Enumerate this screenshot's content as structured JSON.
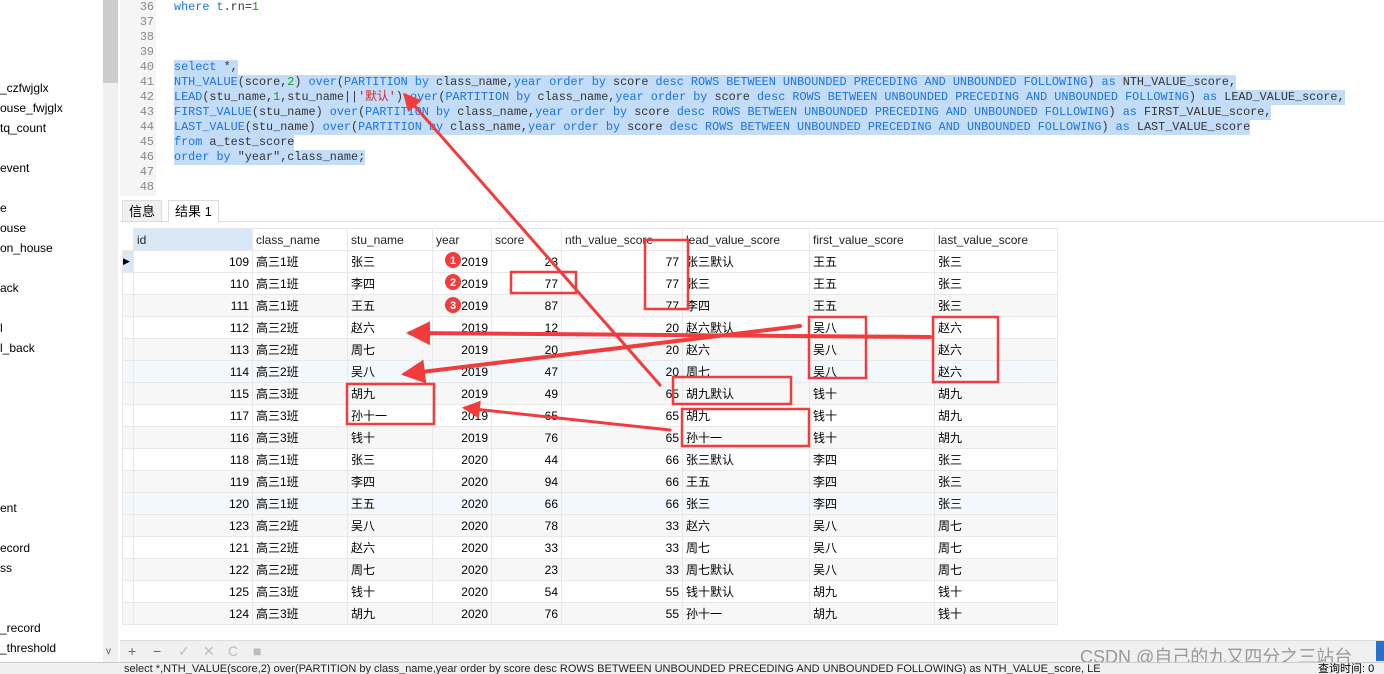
{
  "sidebar": {
    "items": [
      "_czfwjglx",
      "ouse_fwjglx",
      "tq_count",
      "event",
      "e",
      "ouse",
      "on_house",
      "ack",
      "l",
      "l_back",
      "ent",
      "ecord",
      "ss",
      "_record",
      "_threshold"
    ]
  },
  "editor": {
    "lines": [
      {
        "no": "36",
        "sel": false,
        "tokens": [
          [
            "where ",
            "kw"
          ],
          [
            "t",
            "kw"
          ],
          [
            ".rn=",
            "id"
          ],
          [
            "1",
            "num"
          ]
        ]
      },
      {
        "no": "37",
        "sel": false,
        "tokens": []
      },
      {
        "no": "38",
        "sel": false,
        "tokens": []
      },
      {
        "no": "39",
        "sel": false,
        "tokens": []
      },
      {
        "no": "40",
        "sel": true,
        "tokens": [
          [
            "select ",
            "kw"
          ],
          [
            "*,",
            "id"
          ]
        ]
      },
      {
        "no": "41",
        "sel": true,
        "tokens": [
          [
            "NTH_VALUE",
            "kw"
          ],
          [
            "(score,",
            "id"
          ],
          [
            "2",
            "num"
          ],
          [
            ") ",
            "id"
          ],
          [
            "over",
            "kw"
          ],
          [
            "(",
            "id"
          ],
          [
            "PARTITION by ",
            "kw"
          ],
          [
            "class_name,",
            "id"
          ],
          [
            "year order by ",
            "kw"
          ],
          [
            "score ",
            "id"
          ],
          [
            "desc ROWS BETWEEN UNBOUNDED PRECEDING AND UNBOUNDED FOLLOWING",
            "kw"
          ],
          [
            ") ",
            "id"
          ],
          [
            "as ",
            "kw"
          ],
          [
            "NTH_VALUE_score,",
            "id"
          ]
        ]
      },
      {
        "no": "42",
        "sel": true,
        "tokens": [
          [
            "LEAD",
            "kw"
          ],
          [
            "(stu_name,",
            "id"
          ],
          [
            "1",
            "num"
          ],
          [
            ",stu_name||",
            "id"
          ],
          [
            "'默认'",
            "str"
          ],
          [
            ") ",
            "id"
          ],
          [
            "over",
            "kw"
          ],
          [
            "(",
            "id"
          ],
          [
            "PARTITION by ",
            "kw"
          ],
          [
            "class_name,",
            "id"
          ],
          [
            "year order by ",
            "kw"
          ],
          [
            "score ",
            "id"
          ],
          [
            "desc ROWS BETWEEN UNBOUNDED PRECEDING AND UNBOUNDED FOLLOWING",
            "kw"
          ],
          [
            ") ",
            "id"
          ],
          [
            "as ",
            "kw"
          ],
          [
            "LEAD_VALUE_score,",
            "id"
          ]
        ]
      },
      {
        "no": "43",
        "sel": true,
        "tokens": [
          [
            "FIRST_VALUE",
            "kw"
          ],
          [
            "(stu_name) ",
            "id"
          ],
          [
            "over",
            "kw"
          ],
          [
            "(",
            "id"
          ],
          [
            "PARTITION by ",
            "kw"
          ],
          [
            "class_name,",
            "id"
          ],
          [
            "year order by ",
            "kw"
          ],
          [
            "score ",
            "id"
          ],
          [
            "desc ROWS BETWEEN UNBOUNDED PRECEDING AND UNBOUNDED FOLLOWING",
            "kw"
          ],
          [
            ") ",
            "id"
          ],
          [
            "as ",
            "kw"
          ],
          [
            "FIRST_VALUE_score,",
            "id"
          ]
        ]
      },
      {
        "no": "44",
        "sel": true,
        "tokens": [
          [
            "LAST_VALUE",
            "kw"
          ],
          [
            "(stu_name) ",
            "id"
          ],
          [
            "over",
            "kw"
          ],
          [
            "(",
            "id"
          ],
          [
            "PARTITION by ",
            "kw"
          ],
          [
            "class_name,",
            "id"
          ],
          [
            "year order by ",
            "kw"
          ],
          [
            "score ",
            "id"
          ],
          [
            "desc ROWS BETWEEN UNBOUNDED PRECEDING AND UNBOUNDED FOLLOWING",
            "kw"
          ],
          [
            ") ",
            "id"
          ],
          [
            "as ",
            "kw"
          ],
          [
            "LAST_VALUE_score",
            "id"
          ]
        ]
      },
      {
        "no": "45",
        "sel": true,
        "tokens": [
          [
            "from ",
            "kw"
          ],
          [
            "a_test_score",
            "id"
          ]
        ]
      },
      {
        "no": "46",
        "sel": true,
        "tokens": [
          [
            "order by ",
            "kw"
          ],
          [
            "\"year\",class_name;",
            "id"
          ]
        ]
      },
      {
        "no": "47",
        "sel": false,
        "tokens": []
      },
      {
        "no": "48",
        "sel": false,
        "tokens": []
      }
    ]
  },
  "tabs": [
    {
      "label": "信息",
      "active": false
    },
    {
      "label": "结果 1",
      "active": true
    }
  ],
  "grid": {
    "columns": [
      "id",
      "class_name",
      "stu_name",
      "year",
      "score",
      "nth_value_score",
      "lead_value_score",
      "first_value_score",
      "last_value_score"
    ],
    "rows": [
      [
        "109",
        "高三1班",
        "张三",
        "2019",
        "23",
        "77",
        "张三默认",
        "王五",
        "张三"
      ],
      [
        "110",
        "高三1班",
        "李四",
        "2019",
        "77",
        "77",
        "张三",
        "王五",
        "张三"
      ],
      [
        "111",
        "高三1班",
        "王五",
        "2019",
        "87",
        "77",
        "李四",
        "王五",
        "张三"
      ],
      [
        "112",
        "高三2班",
        "赵六",
        "2019",
        "12",
        "20",
        "赵六默认",
        "吴八",
        "赵六"
      ],
      [
        "113",
        "高三2班",
        "周七",
        "2019",
        "20",
        "20",
        "赵六",
        "吴八",
        "赵六"
      ],
      [
        "114",
        "高三2班",
        "吴八",
        "2019",
        "47",
        "20",
        "周七",
        "吴八",
        "赵六"
      ],
      [
        "115",
        "高三3班",
        "胡九",
        "2019",
        "49",
        "65",
        "胡九默认",
        "钱十",
        "胡九"
      ],
      [
        "117",
        "高三3班",
        "孙十一",
        "2019",
        "65",
        "65",
        "胡九",
        "钱十",
        "胡九"
      ],
      [
        "116",
        "高三3班",
        "钱十",
        "2019",
        "76",
        "65",
        "孙十一",
        "钱十",
        "胡九"
      ],
      [
        "118",
        "高三1班",
        "张三",
        "2020",
        "44",
        "66",
        "张三默认",
        "李四",
        "张三"
      ],
      [
        "119",
        "高三1班",
        "李四",
        "2020",
        "94",
        "66",
        "王五",
        "李四",
        "张三"
      ],
      [
        "120",
        "高三1班",
        "王五",
        "2020",
        "66",
        "66",
        "张三",
        "李四",
        "张三"
      ],
      [
        "123",
        "高三2班",
        "吴八",
        "2020",
        "78",
        "33",
        "赵六",
        "吴八",
        "周七"
      ],
      [
        "121",
        "高三2班",
        "赵六",
        "2020",
        "33",
        "33",
        "周七",
        "吴八",
        "周七"
      ],
      [
        "122",
        "高三2班",
        "周七",
        "2020",
        "23",
        "33",
        "周七默认",
        "吴八",
        "周七"
      ],
      [
        "125",
        "高三3班",
        "钱十",
        "2020",
        "54",
        "55",
        "钱十默认",
        "胡九",
        "钱十"
      ],
      [
        "124",
        "高三3班",
        "胡九",
        "2020",
        "76",
        "55",
        "孙十一",
        "胡九",
        "钱十"
      ]
    ],
    "current_row_icon": "row-pointer-icon"
  },
  "toolbar": {
    "buttons": [
      {
        "icon": "plus-icon",
        "glyph": "+"
      },
      {
        "icon": "minus-icon",
        "glyph": "−"
      },
      {
        "icon": "check-icon",
        "glyph": "✓"
      },
      {
        "icon": "cancel-icon",
        "glyph": "✕"
      },
      {
        "icon": "refresh-icon",
        "glyph": "C"
      },
      {
        "icon": "stop-icon",
        "glyph": "■"
      }
    ]
  },
  "status": {
    "sql": "select *,NTH_VALUE(score,2) over(PARTITION by class_name,year order by score desc ROWS BETWEEN UNBOUNDED PRECEDING AND UNBOUNDED FOLLOWING) as NTH_VALUE_score, LE",
    "time": "查询时间: 0"
  },
  "watermark": "CSDN @自己的九又四分之三站台",
  "annotations": {
    "color": "#f03c3c",
    "badges": [
      "1",
      "2",
      "3"
    ]
  }
}
